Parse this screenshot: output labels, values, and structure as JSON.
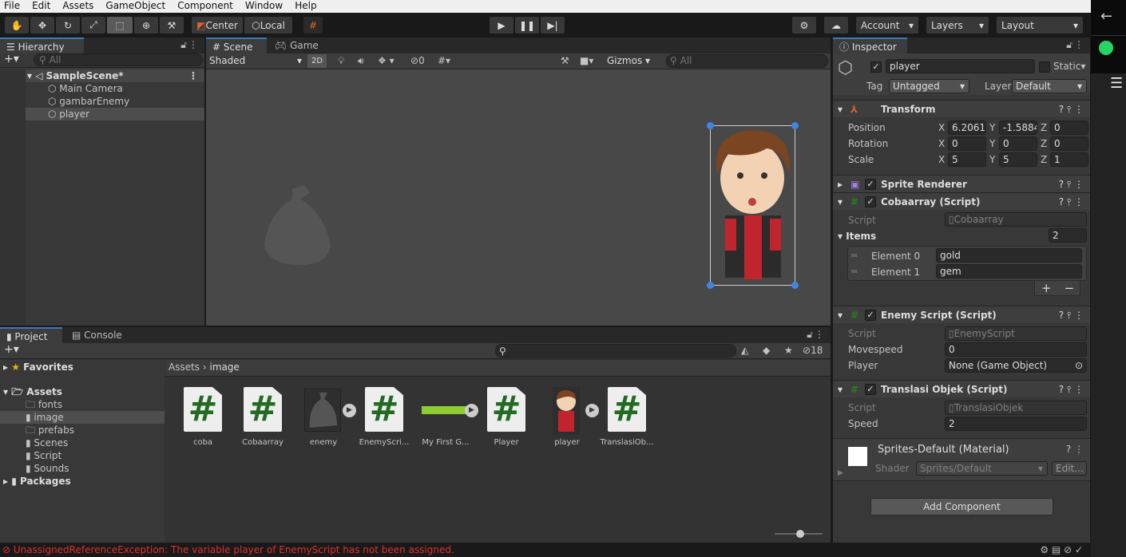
{
  "menu": [
    "File",
    "Edit",
    "Assets",
    "GameObject",
    "Component",
    "Window",
    "Help"
  ],
  "toolbar": {
    "tools": [
      "hand-icon",
      "move-icon",
      "rotate-icon",
      "scale-icon",
      "rect-icon",
      "transform-icon",
      "custom-tool-icon"
    ],
    "pivot": "Center",
    "space": "Local",
    "account": "Account",
    "layers": "Layers",
    "layout": "Layout"
  },
  "hierarchy": {
    "title": "Hierarchy",
    "search_placeholder": "All",
    "scene": "SampleScene*",
    "items": [
      "Main Camera",
      "gambarEnemy",
      "player"
    ]
  },
  "scene": {
    "tab": "Scene",
    "game_tab": "Game",
    "shading": "Shaded",
    "mode2d": "2D",
    "hidden_count": "0",
    "gizmos": "Gizmos",
    "search_placeholder": "All"
  },
  "project": {
    "tab": "Project",
    "console_tab": "Console",
    "hidden_count": "18",
    "favorites": "Favorites",
    "assets": "Assets",
    "folders": [
      "fonts",
      "image",
      "prefabs",
      "Scenes",
      "Script",
      "Sounds"
    ],
    "packages": "Packages",
    "breadcrumb": [
      "Assets",
      "image"
    ],
    "files": [
      {
        "name": "coba",
        "type": "script"
      },
      {
        "name": "Cobaarray",
        "type": "script"
      },
      {
        "name": "enemy",
        "type": "sprite"
      },
      {
        "name": "EnemyScri...",
        "type": "script"
      },
      {
        "name": "My First G...",
        "type": "sprite"
      },
      {
        "name": "Player",
        "type": "script"
      },
      {
        "name": "player",
        "type": "sprite"
      },
      {
        "name": "TranslasiOb...",
        "type": "script"
      }
    ]
  },
  "inspector": {
    "title": "Inspector",
    "name": "player",
    "static": "Static",
    "tag_label": "Tag",
    "tag": "Untagged",
    "layer_label": "Layer",
    "layer": "Default",
    "transform": {
      "title": "Transform",
      "position": {
        "label": "Position",
        "x": "6.20611",
        "y": "-1.5884",
        "z": "0"
      },
      "rotation": {
        "label": "Rotation",
        "x": "0",
        "y": "0",
        "z": "0"
      },
      "scale": {
        "label": "Scale",
        "x": "5",
        "y": "5",
        "z": "1"
      }
    },
    "sprite_renderer": "Sprite Renderer",
    "cobaarray": {
      "title": "Cobaarray (Script)",
      "script_label": "Script",
      "script": "Cobaarray",
      "items_label": "Items",
      "items_count": "2",
      "elements": [
        {
          "label": "Element 0",
          "value": "gold"
        },
        {
          "label": "Element 1",
          "value": "gem"
        }
      ]
    },
    "enemy": {
      "title": "Enemy Script (Script)",
      "script_label": "Script",
      "script": "EnemyScript",
      "movespeed_label": "Movespeed",
      "movespeed": "0",
      "player_label": "Player",
      "player": "None (Game Object)"
    },
    "translasi": {
      "title": "Translasi Objek (Script)",
      "script_label": "Script",
      "script": "TranslasiObjek",
      "speed_label": "Speed",
      "speed": "2"
    },
    "material": {
      "title": "Sprites-Default (Material)",
      "shader_label": "Shader",
      "shader": "Sprites/Default",
      "edit": "Edit..."
    },
    "add_component": "Add Component"
  },
  "axes": [
    "X",
    "Y",
    "Z"
  ],
  "status": {
    "message": "UnassignedReferenceException: The variable player of EnemyScript has not been assigned.",
    "color": "#e03030"
  }
}
